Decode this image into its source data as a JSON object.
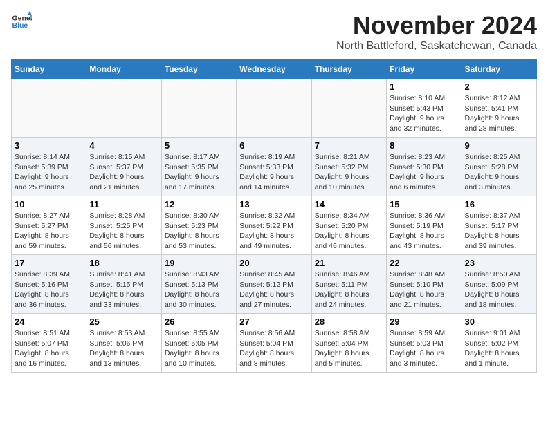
{
  "logo": {
    "line1": "General",
    "line2": "Blue"
  },
  "title": "November 2024",
  "subtitle": "North Battleford, Saskatchewan, Canada",
  "days_of_week": [
    "Sunday",
    "Monday",
    "Tuesday",
    "Wednesday",
    "Thursday",
    "Friday",
    "Saturday"
  ],
  "weeks": [
    {
      "days": [
        {
          "number": "",
          "info": ""
        },
        {
          "number": "",
          "info": ""
        },
        {
          "number": "",
          "info": ""
        },
        {
          "number": "",
          "info": ""
        },
        {
          "number": "",
          "info": ""
        },
        {
          "number": "1",
          "info": "Sunrise: 8:10 AM\nSunset: 5:43 PM\nDaylight: 9 hours\nand 32 minutes."
        },
        {
          "number": "2",
          "info": "Sunrise: 8:12 AM\nSunset: 5:41 PM\nDaylight: 9 hours\nand 28 minutes."
        }
      ]
    },
    {
      "days": [
        {
          "number": "3",
          "info": "Sunrise: 8:14 AM\nSunset: 5:39 PM\nDaylight: 9 hours\nand 25 minutes."
        },
        {
          "number": "4",
          "info": "Sunrise: 8:15 AM\nSunset: 5:37 PM\nDaylight: 9 hours\nand 21 minutes."
        },
        {
          "number": "5",
          "info": "Sunrise: 8:17 AM\nSunset: 5:35 PM\nDaylight: 9 hours\nand 17 minutes."
        },
        {
          "number": "6",
          "info": "Sunrise: 8:19 AM\nSunset: 5:33 PM\nDaylight: 9 hours\nand 14 minutes."
        },
        {
          "number": "7",
          "info": "Sunrise: 8:21 AM\nSunset: 5:32 PM\nDaylight: 9 hours\nand 10 minutes."
        },
        {
          "number": "8",
          "info": "Sunrise: 8:23 AM\nSunset: 5:30 PM\nDaylight: 9 hours\nand 6 minutes."
        },
        {
          "number": "9",
          "info": "Sunrise: 8:25 AM\nSunset: 5:28 PM\nDaylight: 9 hours\nand 3 minutes."
        }
      ]
    },
    {
      "days": [
        {
          "number": "10",
          "info": "Sunrise: 8:27 AM\nSunset: 5:27 PM\nDaylight: 8 hours\nand 59 minutes."
        },
        {
          "number": "11",
          "info": "Sunrise: 8:28 AM\nSunset: 5:25 PM\nDaylight: 8 hours\nand 56 minutes."
        },
        {
          "number": "12",
          "info": "Sunrise: 8:30 AM\nSunset: 5:23 PM\nDaylight: 8 hours\nand 53 minutes."
        },
        {
          "number": "13",
          "info": "Sunrise: 8:32 AM\nSunset: 5:22 PM\nDaylight: 8 hours\nand 49 minutes."
        },
        {
          "number": "14",
          "info": "Sunrise: 8:34 AM\nSunset: 5:20 PM\nDaylight: 8 hours\nand 46 minutes."
        },
        {
          "number": "15",
          "info": "Sunrise: 8:36 AM\nSunset: 5:19 PM\nDaylight: 8 hours\nand 43 minutes."
        },
        {
          "number": "16",
          "info": "Sunrise: 8:37 AM\nSunset: 5:17 PM\nDaylight: 8 hours\nand 39 minutes."
        }
      ]
    },
    {
      "days": [
        {
          "number": "17",
          "info": "Sunrise: 8:39 AM\nSunset: 5:16 PM\nDaylight: 8 hours\nand 36 minutes."
        },
        {
          "number": "18",
          "info": "Sunrise: 8:41 AM\nSunset: 5:15 PM\nDaylight: 8 hours\nand 33 minutes."
        },
        {
          "number": "19",
          "info": "Sunrise: 8:43 AM\nSunset: 5:13 PM\nDaylight: 8 hours\nand 30 minutes."
        },
        {
          "number": "20",
          "info": "Sunrise: 8:45 AM\nSunset: 5:12 PM\nDaylight: 8 hours\nand 27 minutes."
        },
        {
          "number": "21",
          "info": "Sunrise: 8:46 AM\nSunset: 5:11 PM\nDaylight: 8 hours\nand 24 minutes."
        },
        {
          "number": "22",
          "info": "Sunrise: 8:48 AM\nSunset: 5:10 PM\nDaylight: 8 hours\nand 21 minutes."
        },
        {
          "number": "23",
          "info": "Sunrise: 8:50 AM\nSunset: 5:09 PM\nDaylight: 8 hours\nand 18 minutes."
        }
      ]
    },
    {
      "days": [
        {
          "number": "24",
          "info": "Sunrise: 8:51 AM\nSunset: 5:07 PM\nDaylight: 8 hours\nand 16 minutes."
        },
        {
          "number": "25",
          "info": "Sunrise: 8:53 AM\nSunset: 5:06 PM\nDaylight: 8 hours\nand 13 minutes."
        },
        {
          "number": "26",
          "info": "Sunrise: 8:55 AM\nSunset: 5:05 PM\nDaylight: 8 hours\nand 10 minutes."
        },
        {
          "number": "27",
          "info": "Sunrise: 8:56 AM\nSunset: 5:04 PM\nDaylight: 8 hours\nand 8 minutes."
        },
        {
          "number": "28",
          "info": "Sunrise: 8:58 AM\nSunset: 5:04 PM\nDaylight: 8 hours\nand 5 minutes."
        },
        {
          "number": "29",
          "info": "Sunrise: 8:59 AM\nSunset: 5:03 PM\nDaylight: 8 hours\nand 3 minutes."
        },
        {
          "number": "30",
          "info": "Sunrise: 9:01 AM\nSunset: 5:02 PM\nDaylight: 8 hours\nand 1 minute."
        }
      ]
    }
  ]
}
